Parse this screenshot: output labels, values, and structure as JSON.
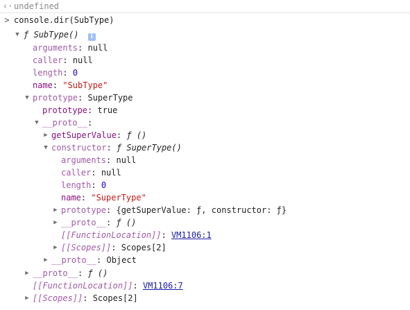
{
  "previous_result": {
    "prefix": "<·",
    "text": "undefined"
  },
  "input": {
    "prompt": ">",
    "command": "console.dir(SubType)"
  },
  "tree": {
    "root": {
      "f": "ƒ",
      "name": "SubType()",
      "info": "i"
    },
    "arguments": {
      "key": "arguments",
      "value": "null"
    },
    "caller": {
      "key": "caller",
      "value": "null"
    },
    "length": {
      "key": "length",
      "value": "0"
    },
    "name": {
      "key": "name",
      "value": "\"SubType\""
    },
    "prototype": {
      "key": "prototype",
      "value": "SuperType"
    },
    "prototype_inner": {
      "key": "prototype",
      "value": "true"
    },
    "proto": {
      "key": "__proto__",
      "colon": ":"
    },
    "getSuperValue": {
      "key": "getSuperValue",
      "value": "ƒ ()"
    },
    "constructor": {
      "key": "constructor",
      "value": "ƒ SuperType()"
    },
    "c_arguments": {
      "key": "arguments",
      "value": "null"
    },
    "c_caller": {
      "key": "caller",
      "value": "null"
    },
    "c_length": {
      "key": "length",
      "value": "0"
    },
    "c_name": {
      "key": "name",
      "value": "\"SuperType\""
    },
    "c_prototype": {
      "key": "prototype",
      "value": "{getSuperValue: ƒ, constructor: ƒ}"
    },
    "c_proto": {
      "key": "__proto__",
      "value": "ƒ ()"
    },
    "c_location": {
      "key": "[[FunctionLocation]]",
      "value": "VM1106:1"
    },
    "c_scopes": {
      "key": "[[Scopes]]",
      "value": "Scopes[2]"
    },
    "proto_object": {
      "key": "__proto__",
      "value": "Object"
    },
    "root_proto": {
      "key": "__proto__",
      "value": "ƒ ()"
    },
    "root_location": {
      "key": "[[FunctionLocation]]",
      "value": "VM1106:7"
    },
    "root_scopes": {
      "key": "[[Scopes]]",
      "value": "Scopes[2]"
    }
  },
  "colors": {
    "key": "#881280",
    "number": "#1c00cf",
    "string": "#c41a16",
    "link": "#1a1aa6",
    "muted": "#8a8a8a"
  },
  "icons": {
    "expanded": "triangle-down-icon",
    "collapsed": "triangle-right-icon",
    "info": "info-icon",
    "prompt": "chevron-right-icon",
    "result": "return-arrow-icon"
  }
}
